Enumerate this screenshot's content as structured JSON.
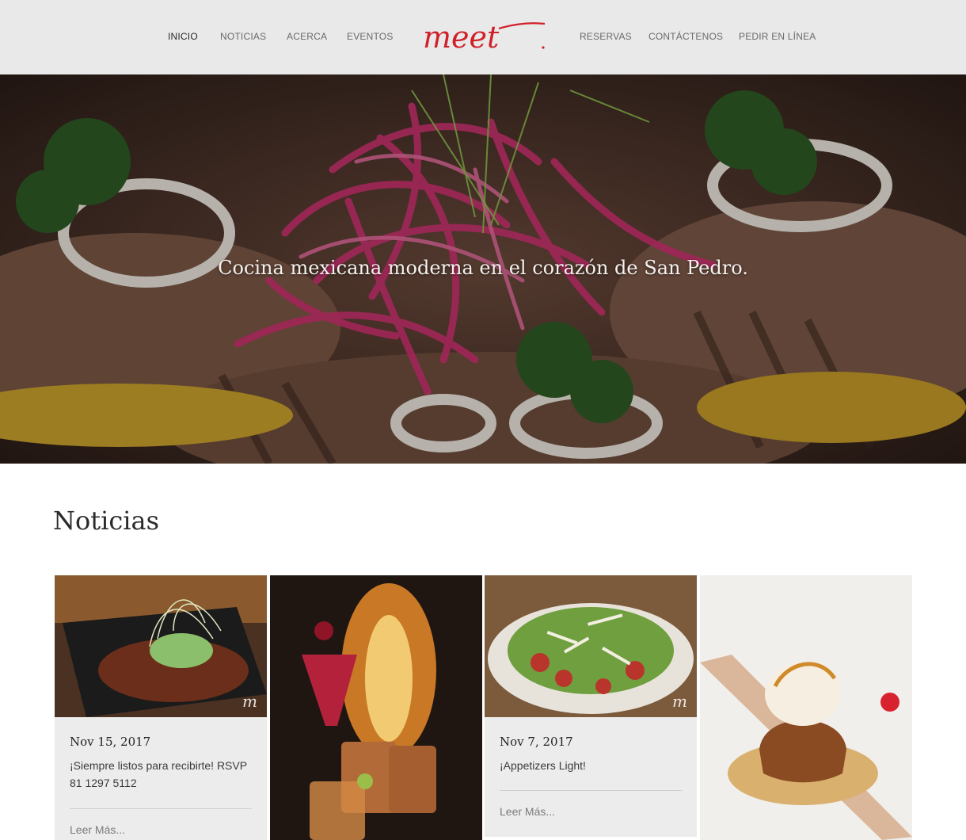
{
  "header": {
    "nav_left": [
      "INICIO",
      "NOTICIAS",
      "ACERCA",
      "EVENTOS"
    ],
    "nav_right": [
      "RESERVAS",
      "CONTÁCTENOS",
      "PEDIR EN LÍNEA"
    ],
    "logo_text": "meet",
    "active_item": "INICIO"
  },
  "hero": {
    "tagline": "Cocina mexicana moderna en el corazón de San Pedro."
  },
  "news": {
    "title": "Noticias",
    "cards": [
      {
        "date": "Nov 15, 2017",
        "text": "¡Siempre listos para recibirte! RSVP 81 1297 5112",
        "more": "Leer Más..."
      },
      {
        "date": "Nov 7, 2017",
        "text": "¡Appetizers Light!",
        "more": "Leer Más..."
      }
    ],
    "watermark": "m"
  },
  "colors": {
    "header_bg": "#e9e9e9",
    "logo_red": "#d0212a",
    "card_bg": "#ececec"
  }
}
